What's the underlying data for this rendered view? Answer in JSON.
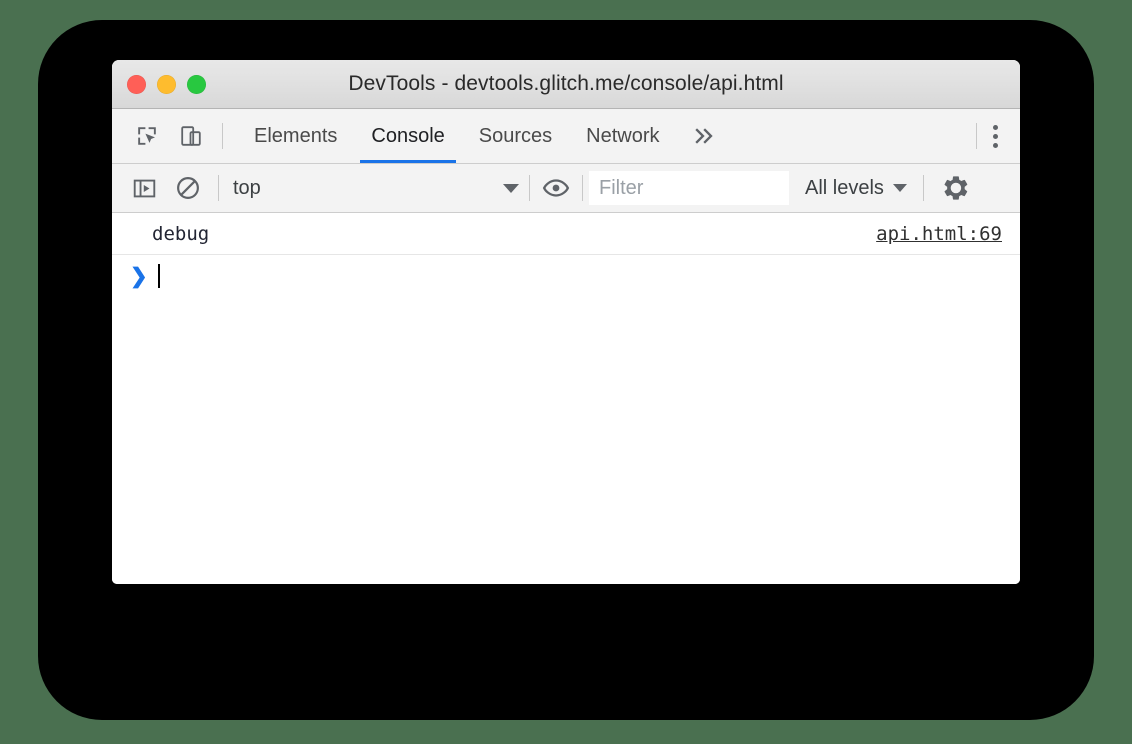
{
  "window": {
    "title": "DevTools - devtools.glitch.me/console/api.html",
    "traffic_lights": [
      {
        "name": "close",
        "color": "#ff5f57"
      },
      {
        "name": "minimize",
        "color": "#febc2e"
      },
      {
        "name": "zoom",
        "color": "#28c840"
      }
    ]
  },
  "tabbar": {
    "left_icons": [
      {
        "name": "inspect-element-icon"
      },
      {
        "name": "device-toolbar-icon"
      }
    ],
    "tabs": [
      {
        "label": "Elements",
        "active": false
      },
      {
        "label": "Console",
        "active": true
      },
      {
        "label": "Sources",
        "active": false
      },
      {
        "label": "Network",
        "active": false
      }
    ],
    "overflow_label": "»",
    "menu_icon": "kebab-menu-icon",
    "active_tab_color": "#1a73e8"
  },
  "console_toolbar": {
    "sidebar_toggle_icon": "console-sidebar-icon",
    "clear_icon": "clear-console-icon",
    "context": {
      "value": "top",
      "caret": "▼"
    },
    "eye_icon": "live-expression-eye-icon",
    "filter": {
      "value": "",
      "placeholder": "Filter"
    },
    "levels": {
      "label": "All levels",
      "caret": "▼"
    },
    "settings_icon": "settings-gear-icon"
  },
  "console_body": {
    "messages": [
      {
        "text": "debug",
        "source": "api.html:69"
      }
    ],
    "prompt": {
      "chevron": "❯",
      "input_value": ""
    }
  },
  "colors": {
    "page_background": "#4a7050",
    "backdrop": "#000000",
    "window_background": "#ffffff",
    "toolbar_background": "#f3f3f3",
    "accent": "#1a73e8"
  }
}
